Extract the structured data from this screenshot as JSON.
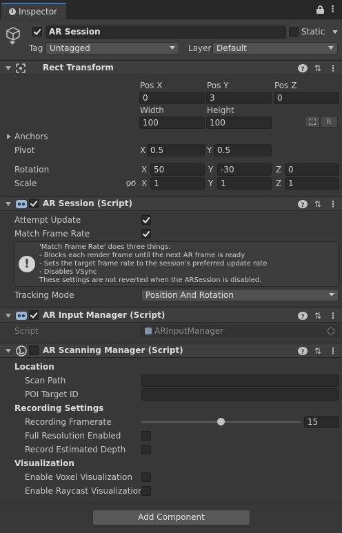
{
  "tab": {
    "title": "Inspector"
  },
  "gameobject": {
    "name": "AR Session",
    "static_label": "Static",
    "tag_label": "Tag",
    "tag_value": "Untagged",
    "layer_label": "Layer",
    "layer_value": "Default"
  },
  "rect_transform": {
    "title": "Rect Transform",
    "pos_x_label": "Pos X",
    "pos_y_label": "Pos Y",
    "pos_z_label": "Pos Z",
    "pos_x": "0",
    "pos_y": "3",
    "pos_z": "0",
    "width_label": "Width",
    "height_label": "Height",
    "width": "100",
    "height": "100",
    "r_button": "R",
    "anchors_label": "Anchors",
    "pivot_label": "Pivot",
    "pivot_x": "0.5",
    "pivot_y": "0.5",
    "rotation_label": "Rotation",
    "rot_x": "50",
    "rot_y": "-30",
    "rot_z": "0",
    "scale_label": "Scale",
    "scale_x": "1",
    "scale_y": "1",
    "scale_z": "1",
    "x": "X",
    "y": "Y",
    "z": "Z"
  },
  "ar_session": {
    "title": "AR Session (Script)",
    "attempt_update_label": "Attempt Update",
    "attempt_update": true,
    "match_frame_rate_label": "Match Frame Rate",
    "match_frame_rate": true,
    "help_lines": [
      "'Match Frame Rate' does three things:",
      "- Blocks each render frame until the next AR frame is ready",
      "- Sets the target frame rate to the session's preferred update rate",
      "- Disables VSync",
      "These settings are not reverted when the ARSession is disabled."
    ],
    "tracking_mode_label": "Tracking Mode",
    "tracking_mode": "Position And Rotation"
  },
  "ar_input_manager": {
    "title": "AR Input Manager (Script)",
    "script_label": "Script",
    "script_value": "ARInputManager"
  },
  "ar_scanning_manager": {
    "title": "AR Scanning Manager (Script)",
    "location_header": "Location",
    "scan_path_label": "Scan Path",
    "scan_path": "",
    "poi_target_label": "POI Target ID",
    "poi_target": "",
    "recording_header": "Recording Settings",
    "framerate_label": "Recording Framerate",
    "framerate": "15",
    "framerate_slider_fraction": 0.5,
    "full_res_label": "Full Resolution Enabled",
    "full_res": false,
    "depth_label": "Record Estimated Depth",
    "depth": false,
    "visualization_header": "Visualization",
    "voxel_label": "Enable Voxel Visualization",
    "voxel": false,
    "raycast_label": "Enable Raycast Visualization",
    "raycast": false
  },
  "add_component": "Add Component",
  "icons": {
    "help": "?",
    "preset": "⇅",
    "menu": "⋮",
    "lock": "lock-icon"
  }
}
